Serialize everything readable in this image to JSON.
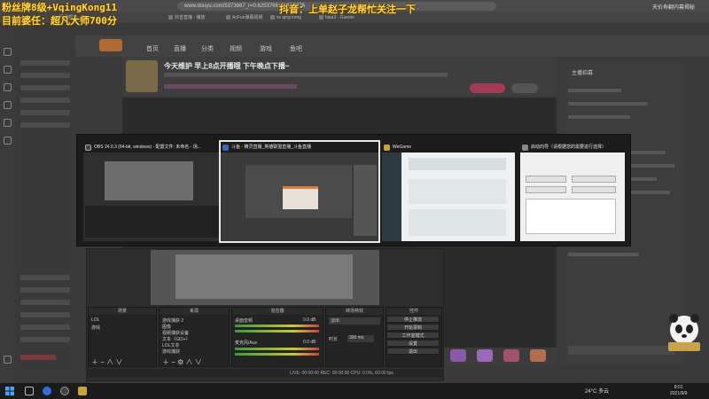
{
  "overlay": {
    "line1": "粉丝牌8级+VqingKong11",
    "line2": "目前婆任：超凡大师700分",
    "right": "抖音：上单赵子龙帮忙关注一下"
  },
  "browser": {
    "url": "www.douyu.com/5373667_r=0.6253766480150376",
    "bookmarks": [
      "网易邮箱",
      "抖音直播 - 播放",
      "AcFun弹幕视频",
      "xx qing kong",
      "bala3 - Guesto"
    ],
    "tab_extras": "天价寿翻内幕揭秘"
  },
  "site": {
    "nav": [
      "首页",
      "直播",
      "分类",
      "视频",
      "游戏",
      "鱼吧"
    ]
  },
  "room": {
    "title": "今天维护 早上8点开播哦 下午晚点下播~"
  },
  "sidebar": {
    "chat_label": "主播招募"
  },
  "switcher": {
    "windows": [
      {
        "title": "OBS 24.0.3 (64-bit, windows) - 配置文件: 未命名 - 场...",
        "icon_color": "#444"
      },
      {
        "title": "斗鱼 - 精灵直播_英雄联盟直播_斗鱼直播",
        "icon_color": "#3a6ab5"
      },
      {
        "title": "WeGame",
        "icon_color": "#c8a23c"
      },
      {
        "title": "启动向导（请根据您的需要进行选择）",
        "icon_color": "#888"
      }
    ]
  },
  "obs": {
    "docks": {
      "scenes": {
        "title": "场景",
        "items": [
          "LOL",
          "游戏"
        ]
      },
      "sources": {
        "title": "来源",
        "items": [
          "游戏捕获 2",
          "图像",
          "视频捕获设备",
          "文本（GDI+）",
          "LOL文本",
          "游戏捕获"
        ]
      },
      "mixer": {
        "title": "混音器",
        "items": [
          "桌面音频",
          "麦克风/Aux"
        ],
        "levels": [
          "0.0 dB",
          "0.0 dB"
        ]
      },
      "transitions": {
        "title": "转场特效",
        "mode": "淡出",
        "duration_label": "时长",
        "duration": "300 ms"
      },
      "controls": {
        "title": "控件",
        "buttons": [
          "停止推流",
          "开始录制",
          "工作室模式",
          "设置",
          "退出"
        ]
      }
    },
    "status": "LIVE: 00:00:00   REC: 00:00:00   CPU: 0.0%, 60.00 fps"
  },
  "taskbar": {
    "weather": "24°C  多云",
    "time": "8:01",
    "date": "2021/9/9"
  }
}
